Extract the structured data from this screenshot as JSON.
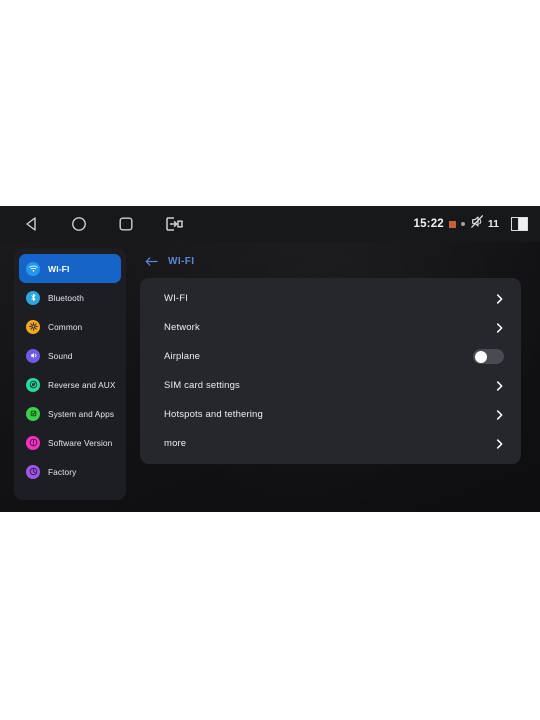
{
  "statusbar": {
    "nav": [
      {
        "name": "back-nav-icon",
        "label": "Back"
      },
      {
        "name": "home-nav-icon",
        "label": "Home"
      },
      {
        "name": "recents-nav-icon",
        "label": "Recents"
      },
      {
        "name": "screen-cast-icon",
        "label": "Cast"
      }
    ],
    "time": "15:22",
    "indicator_square": "orange-square-icon",
    "indicator_dot": "small-dot-icon",
    "volume_icon": "mute-speaker-icon",
    "volume_level": "11",
    "battery_icon": "battery-icon",
    "colors": {
      "bar_bg": "#17181a",
      "text": "#f2f2f2",
      "orange": "#c4603a"
    }
  },
  "sidebar": {
    "items": [
      {
        "label": "WI-FI",
        "icon": "wifi-icon",
        "color": "#2196f3",
        "selected": true
      },
      {
        "label": "Bluetooth",
        "icon": "bluetooth-icon",
        "color": "#29a8df",
        "selected": false
      },
      {
        "label": "Common",
        "icon": "gear-icon",
        "color": "#f5a623",
        "selected": false
      },
      {
        "label": "Sound",
        "icon": "sound-icon",
        "color": "#6c5ce7",
        "selected": false
      },
      {
        "label": "Reverse and AUX",
        "icon": "reverse-aux-icon",
        "color": "#2bd9a0",
        "selected": false
      },
      {
        "label": "System and Apps",
        "icon": "system-apps-icon",
        "color": "#3ecf4a",
        "selected": false
      },
      {
        "label": "Software Version",
        "icon": "software-version-icon",
        "color": "#f033c0",
        "selected": false
      },
      {
        "label": "Factory",
        "icon": "factory-icon",
        "color": "#a057e8",
        "selected": false
      }
    ],
    "selected_bg": "#1565c8",
    "panel_bg": "#1d1e24"
  },
  "content": {
    "back_icon": "back-arrow-icon",
    "title": "WI-FI",
    "title_color": "#5b86d6",
    "rows": [
      {
        "label": "WI-FI",
        "control": "chevron"
      },
      {
        "label": "Network",
        "control": "chevron"
      },
      {
        "label": "Airplane",
        "control": "toggle",
        "toggle_on": false
      },
      {
        "label": "SIM card settings",
        "control": "chevron"
      },
      {
        "label": "Hotspots and tethering",
        "control": "chevron"
      },
      {
        "label": "more",
        "control": "chevron"
      }
    ],
    "panel_bg": "#26272c"
  }
}
